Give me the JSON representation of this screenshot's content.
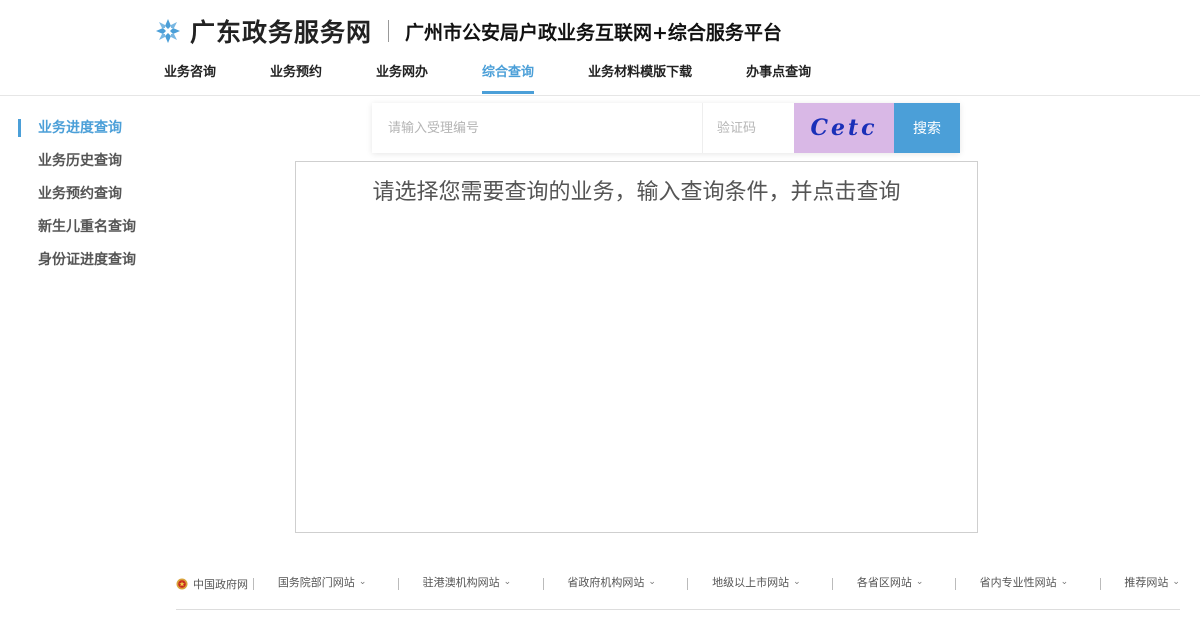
{
  "header": {
    "site_name": "广东政务服务网",
    "platform_title": "广州市公安局户政业务互联网+综合服务平台"
  },
  "nav": {
    "items": [
      {
        "label": "业务咨询"
      },
      {
        "label": "业务预约"
      },
      {
        "label": "业务网办"
      },
      {
        "label": "综合查询"
      },
      {
        "label": "业务材料模版下载"
      },
      {
        "label": "办事点查询"
      }
    ],
    "active_index": 3
  },
  "sidebar": {
    "items": [
      {
        "label": "业务进度查询"
      },
      {
        "label": "业务历史查询"
      },
      {
        "label": "业务预约查询"
      },
      {
        "label": "新生儿重名查询"
      },
      {
        "label": "身份证进度查询"
      }
    ],
    "active_index": 0
  },
  "search": {
    "placeholder": "请输入受理编号",
    "value": "",
    "captcha_placeholder": "验证码",
    "captcha_text": "Cetc",
    "button_label": "搜索"
  },
  "result": {
    "hint": "请选择您需要查询的业务，输入查询条件，并点击查询"
  },
  "footer": {
    "gov_link": "中国政府网",
    "items": [
      {
        "label": "国务院部门网站"
      },
      {
        "label": "驻港澳机构网站"
      },
      {
        "label": "省政府机构网站"
      },
      {
        "label": "地级以上市网站"
      },
      {
        "label": "各省区网站"
      },
      {
        "label": "省内专业性网站"
      },
      {
        "label": "推荐网站"
      }
    ]
  },
  "colors": {
    "accent": "#4b9fd8",
    "captcha_bg": "#d9b8e6",
    "captcha_text": "#1a2fb8"
  }
}
